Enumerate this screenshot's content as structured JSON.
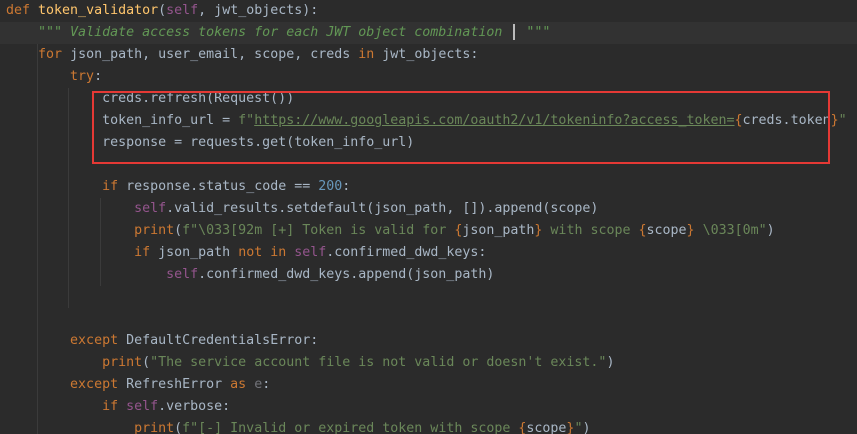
{
  "code": {
    "lines": [
      [
        {
          "t": "def ",
          "c": "kw"
        },
        {
          "t": "token_validator",
          "c": "fn"
        },
        {
          "t": "(",
          "c": "pl"
        },
        {
          "t": "self",
          "c": "self"
        },
        {
          "t": ", jwt_objects):",
          "c": "pl"
        }
      ],
      [
        {
          "t": "    ",
          "c": "pl"
        },
        {
          "t": "\"\"\" Validate access tokens for each JWT object combination ",
          "c": "doc"
        },
        {
          "caret": true
        },
        {
          "t": " \"\"\"",
          "c": "doc"
        }
      ],
      [
        {
          "t": "    ",
          "c": "pl"
        },
        {
          "t": "for ",
          "c": "kw"
        },
        {
          "t": "json_path, user_email, scope, creds ",
          "c": "pl"
        },
        {
          "t": "in ",
          "c": "kw"
        },
        {
          "t": "jwt_objects:",
          "c": "pl"
        }
      ],
      [
        {
          "t": "        ",
          "c": "pl"
        },
        {
          "t": "try",
          "c": "kw"
        },
        {
          "t": ":",
          "c": "pl"
        }
      ],
      [
        {
          "t": "            creds.refresh(Request())",
          "c": "pl"
        }
      ],
      [
        {
          "t": "            token_info_url = ",
          "c": "pl"
        },
        {
          "t": "f\"",
          "c": "str"
        },
        {
          "t": "https://www.googleapis.com/oauth2/v1/tokeninfo?access_token=",
          "c": "url"
        },
        {
          "t": "{",
          "c": "brace"
        },
        {
          "t": "creds.token",
          "c": "pl"
        },
        {
          "t": "}",
          "c": "brace"
        },
        {
          "t": "\"",
          "c": "str"
        }
      ],
      [
        {
          "t": "            response = requests.get(token_info_url)",
          "c": "pl"
        }
      ],
      [
        {
          "t": "",
          "c": "pl"
        }
      ],
      [
        {
          "t": "            ",
          "c": "pl"
        },
        {
          "t": "if ",
          "c": "kw"
        },
        {
          "t": "response.status_code == ",
          "c": "pl"
        },
        {
          "t": "200",
          "c": "num"
        },
        {
          "t": ":",
          "c": "pl"
        }
      ],
      [
        {
          "t": "                ",
          "c": "pl"
        },
        {
          "t": "self",
          "c": "self"
        },
        {
          "t": ".valid_results.setdefault(json_path, []).append(scope)",
          "c": "pl"
        }
      ],
      [
        {
          "t": "                ",
          "c": "pl"
        },
        {
          "t": "print",
          "c": "kw"
        },
        {
          "t": "(",
          "c": "pl"
        },
        {
          "t": "f\"\\033[92m [+] Token is valid for ",
          "c": "str"
        },
        {
          "t": "{",
          "c": "brace"
        },
        {
          "t": "json_path",
          "c": "pl"
        },
        {
          "t": "}",
          "c": "brace"
        },
        {
          "t": " with scope ",
          "c": "str"
        },
        {
          "t": "{",
          "c": "brace"
        },
        {
          "t": "scope",
          "c": "pl"
        },
        {
          "t": "}",
          "c": "brace"
        },
        {
          "t": " \\033[0m\"",
          "c": "str"
        },
        {
          "t": ")",
          "c": "pl"
        }
      ],
      [
        {
          "t": "                ",
          "c": "pl"
        },
        {
          "t": "if ",
          "c": "kw"
        },
        {
          "t": "json_path ",
          "c": "pl"
        },
        {
          "t": "not in ",
          "c": "kw"
        },
        {
          "t": "self",
          "c": "self"
        },
        {
          "t": ".confirmed_dwd_keys:",
          "c": "pl"
        }
      ],
      [
        {
          "t": "                    ",
          "c": "pl"
        },
        {
          "t": "self",
          "c": "self"
        },
        {
          "t": ".confirmed_dwd_keys.append(json_path)",
          "c": "pl"
        }
      ],
      [
        {
          "t": "",
          "c": "pl"
        }
      ],
      [
        {
          "t": "",
          "c": "pl"
        }
      ],
      [
        {
          "t": "        ",
          "c": "pl"
        },
        {
          "t": "except ",
          "c": "kw"
        },
        {
          "t": "DefaultCredentialsError:",
          "c": "pl"
        }
      ],
      [
        {
          "t": "            ",
          "c": "pl"
        },
        {
          "t": "print",
          "c": "kw"
        },
        {
          "t": "(",
          "c": "pl"
        },
        {
          "t": "\"The service account file is not valid or doesn't exist.\"",
          "c": "str"
        },
        {
          "t": ")",
          "c": "pl"
        }
      ],
      [
        {
          "t": "        ",
          "c": "pl"
        },
        {
          "t": "except ",
          "c": "kw"
        },
        {
          "t": "RefreshError ",
          "c": "pl"
        },
        {
          "t": "as ",
          "c": "kw"
        },
        {
          "t": "e",
          "c": "unused"
        },
        {
          "t": ":",
          "c": "pl"
        }
      ],
      [
        {
          "t": "            ",
          "c": "pl"
        },
        {
          "t": "if ",
          "c": "kw"
        },
        {
          "t": "self",
          "c": "self"
        },
        {
          "t": ".verbose:",
          "c": "pl"
        }
      ],
      [
        {
          "t": "                ",
          "c": "pl"
        },
        {
          "t": "print",
          "c": "kw"
        },
        {
          "t": "(",
          "c": "pl"
        },
        {
          "t": "f\"[-] Invalid or expired token with scope ",
          "c": "str"
        },
        {
          "t": "{",
          "c": "brace"
        },
        {
          "t": "scope",
          "c": "pl"
        },
        {
          "t": "}",
          "c": "brace"
        },
        {
          "t": "\"",
          "c": "str"
        },
        {
          "t": ")",
          "c": "pl"
        }
      ]
    ],
    "current_line": 1
  },
  "colors": {
    "background": "#2b2b2b",
    "keyword": "#cc7832",
    "function": "#ffc66d",
    "self": "#94558d",
    "string": "#6a8759",
    "docstring": "#629755",
    "number": "#6897bb",
    "highlight_box": "#e53935"
  }
}
